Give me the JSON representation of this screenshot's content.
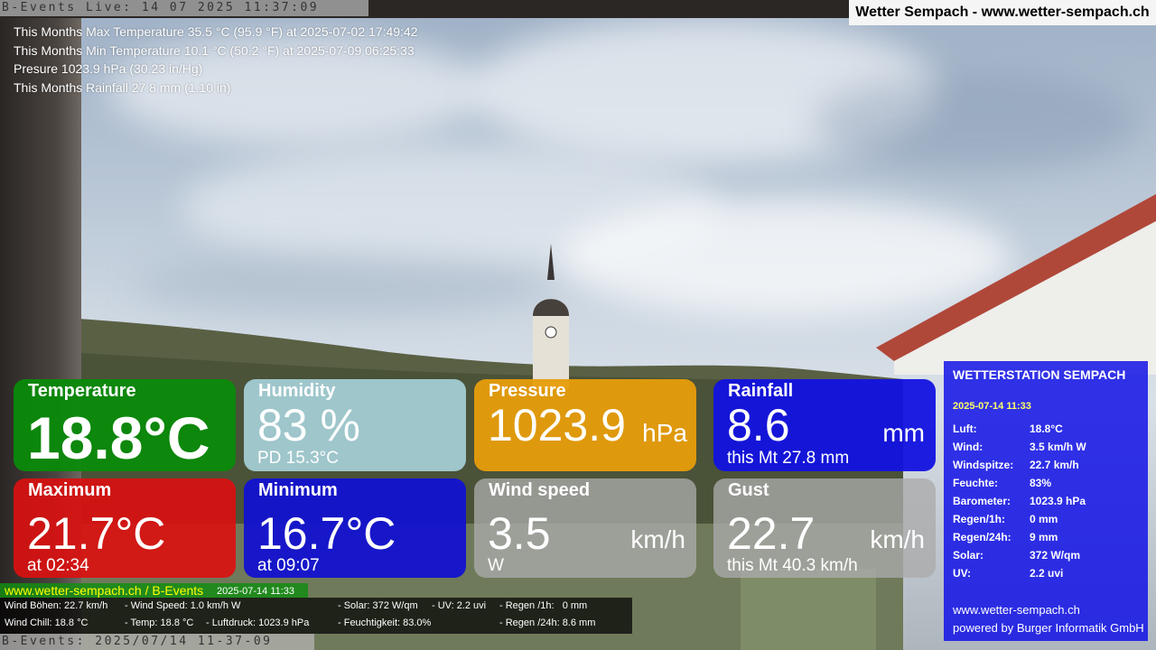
{
  "overlay": {
    "timestamp_top": "B-Events Live: 14 07 2025 11:37:09",
    "timestamp_bottom": "B-Events: 2025/07/14 11-37-09",
    "site_title": "Wetter Sempach - www.wetter-sempach.ch"
  },
  "stats": {
    "max_temp": "This Months Max Temperature 35.5 °C (95.9 °F) at 2025-07-02 17:49:42",
    "min_temp": "This Months Min Temperature 10.1 °C (50.2 °F) at 2025-07-09 06:25:33",
    "pressure": "Presure 1023.9 hPa (30.23 in/Hg)",
    "rainfall": "This Months Rainfall 27.8 mm (1.10 in)"
  },
  "tiles": {
    "temperature": {
      "label": "Temperature",
      "value": "18.8°C",
      "color": "#0a8a0a"
    },
    "humidity": {
      "label": "Humidity",
      "value": "83 %",
      "sub": "PD 15.3°C",
      "color": "#a7d3dc"
    },
    "pressure": {
      "label": "Pressure",
      "value": "1023.9",
      "unit": "hPa",
      "color": "#e79d0a"
    },
    "rainfall": {
      "label": "Rainfall",
      "value": "8.6",
      "unit": "mm",
      "sub": "this Mt 27.8 mm",
      "color": "#1212e0"
    },
    "maximum": {
      "label": "Maximum",
      "value": "21.7°C",
      "sub": "at 02:34",
      "color": "#d91010"
    },
    "minimum": {
      "label": "Minimum",
      "value": "16.7°C",
      "sub": "at 09:07",
      "color": "#1212d0"
    },
    "wind_speed": {
      "label": "Wind speed",
      "value": "3.5",
      "unit": "km/h",
      "sub": "W",
      "color": "#aaaaaa"
    },
    "gust": {
      "label": "Gust",
      "value": "22.7",
      "unit": "km/h",
      "sub": "this Mt 40.3 km/h",
      "color": "#aaaaaa"
    }
  },
  "station": {
    "title": "WETTERSTATION SEMPACH",
    "datetime": "2025-07-14 11:33",
    "rows": [
      {
        "k": "Luft:",
        "v": "18.8°C"
      },
      {
        "k": "Wind:",
        "v": "3.5 km/h  W"
      },
      {
        "k": "Windspitze:",
        "v": "22.7 km/h"
      },
      {
        "k": "Feuchte:",
        "v": "83%"
      },
      {
        "k": "Barometer:",
        "v": "1023.9 hPa"
      },
      {
        "k": "Regen/1h:",
        "v": "0 mm"
      },
      {
        "k": "Regen/24h:",
        "v": "9 mm"
      },
      {
        "k": "Solar:",
        "v": "372 W/qm"
      },
      {
        "k": "UV:",
        "v": "2.2 uvi"
      }
    ],
    "url": "www.wetter-sempach.ch",
    "powered_by": "powered by Burger Informatik GmbH"
  },
  "ticker": {
    "site": "www.wetter-sempach.ch / B-Events",
    "datetime": "2025-07-14 11:33",
    "wind_gusts": "Wind Böhen: 22.7 km/h",
    "wind_speed": "- Wind Speed: 1.0 km/h W",
    "solar": "- Solar: 372 W/qm",
    "uv": "- UV: 2.2 uvi",
    "rain_1h": "- Regen /1h:   0 mm",
    "wind_chill": "Wind Chill: 18.8 °C",
    "temp": "- Temp: 18.8 °C",
    "pressure": "- Luftdruck: 1023.9 hPa",
    "humidity": "- Feuchtigkeit: 83.0%",
    "rain_24h": "- Regen /24h: 8.6 mm"
  }
}
